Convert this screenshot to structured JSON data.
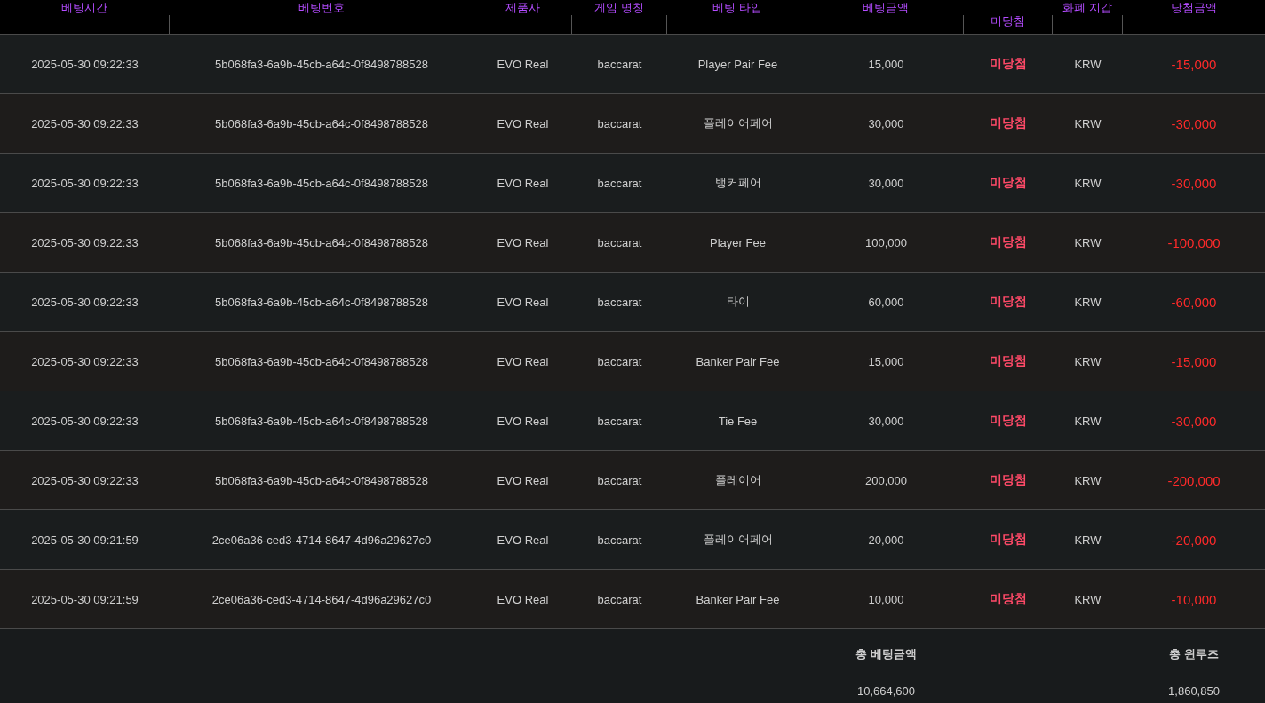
{
  "table": {
    "columns": [
      "베팅시간",
      "베팅번호",
      "제품사",
      "게임 명칭",
      "베팅 타입",
      "베팅금액",
      "미당첨",
      "화폐 지갑",
      "당첨금액"
    ],
    "rows": [
      {
        "time": "2025-05-30 09:22:33",
        "bet_id": "5b068fa3-6a9b-45cb-a64c-0f8498788528",
        "provider": "EVO Real",
        "game": "baccarat",
        "bet_type": "Player Pair Fee",
        "amount": "15,000",
        "result": "미당첨",
        "currency": "KRW",
        "win_amount": "-15,000"
      },
      {
        "time": "2025-05-30 09:22:33",
        "bet_id": "5b068fa3-6a9b-45cb-a64c-0f8498788528",
        "provider": "EVO Real",
        "game": "baccarat",
        "bet_type": "플레이어페어",
        "amount": "30,000",
        "result": "미당첨",
        "currency": "KRW",
        "win_amount": "-30,000"
      },
      {
        "time": "2025-05-30 09:22:33",
        "bet_id": "5b068fa3-6a9b-45cb-a64c-0f8498788528",
        "provider": "EVO Real",
        "game": "baccarat",
        "bet_type": "뱅커페어",
        "amount": "30,000",
        "result": "미당첨",
        "currency": "KRW",
        "win_amount": "-30,000"
      },
      {
        "time": "2025-05-30 09:22:33",
        "bet_id": "5b068fa3-6a9b-45cb-a64c-0f8498788528",
        "provider": "EVO Real",
        "game": "baccarat",
        "bet_type": "Player Fee",
        "amount": "100,000",
        "result": "미당첨",
        "currency": "KRW",
        "win_amount": "-100,000"
      },
      {
        "time": "2025-05-30 09:22:33",
        "bet_id": "5b068fa3-6a9b-45cb-a64c-0f8498788528",
        "provider": "EVO Real",
        "game": "baccarat",
        "bet_type": "타이",
        "amount": "60,000",
        "result": "미당첨",
        "currency": "KRW",
        "win_amount": "-60,000"
      },
      {
        "time": "2025-05-30 09:22:33",
        "bet_id": "5b068fa3-6a9b-45cb-a64c-0f8498788528",
        "provider": "EVO Real",
        "game": "baccarat",
        "bet_type": "Banker Pair Fee",
        "amount": "15,000",
        "result": "미당첨",
        "currency": "KRW",
        "win_amount": "-15,000"
      },
      {
        "time": "2025-05-30 09:22:33",
        "bet_id": "5b068fa3-6a9b-45cb-a64c-0f8498788528",
        "provider": "EVO Real",
        "game": "baccarat",
        "bet_type": "Tie Fee",
        "amount": "30,000",
        "result": "미당첨",
        "currency": "KRW",
        "win_amount": "-30,000"
      },
      {
        "time": "2025-05-30 09:22:33",
        "bet_id": "5b068fa3-6a9b-45cb-a64c-0f8498788528",
        "provider": "EVO Real",
        "game": "baccarat",
        "bet_type": "플레이어",
        "amount": "200,000",
        "result": "미당첨",
        "currency": "KRW",
        "win_amount": "-200,000"
      },
      {
        "time": "2025-05-30 09:21:59",
        "bet_id": "2ce06a36-ced3-4714-8647-4d96a29627c0",
        "provider": "EVO Real",
        "game": "baccarat",
        "bet_type": "플레이어페어",
        "amount": "20,000",
        "result": "미당첨",
        "currency": "KRW",
        "win_amount": "-20,000"
      },
      {
        "time": "2025-05-30 09:21:59",
        "bet_id": "2ce06a36-ced3-4714-8647-4d96a29627c0",
        "provider": "EVO Real",
        "game": "baccarat",
        "bet_type": "Banker Pair Fee",
        "amount": "10,000",
        "result": "미당첨",
        "currency": "KRW",
        "win_amount": "-10,000"
      }
    ]
  },
  "totals": {
    "bet_label": "총 베팅금액",
    "bet_value": "10,664,600",
    "winloss_label": "총 윈루즈",
    "winloss_value": "1,860,850"
  }
}
